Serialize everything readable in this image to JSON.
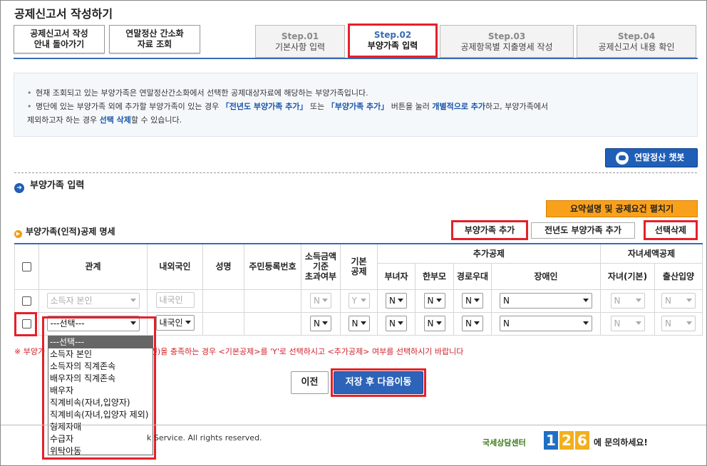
{
  "page": {
    "title": "공제신고서 작성하기"
  },
  "top_buttons": {
    "guide": [
      "공제신고서 작성",
      "안내 돌아가기"
    ],
    "lookup": [
      "연말정산 간소화",
      "자료 조회"
    ]
  },
  "steps": [
    {
      "num": "Step.01",
      "label": "기본사항 입력"
    },
    {
      "num": "Step.02",
      "label": "부양가족 입력"
    },
    {
      "num": "Step.03",
      "label": "공제항목별 지출명세 작성"
    },
    {
      "num": "Step.04",
      "label": "공제신고서 내용 확인"
    }
  ],
  "info": {
    "line1": "현재 조회되고 있는 부양가족은 연말정산간소화에서 선택한 공제대상자료에 해당하는 부양가족입니다.",
    "line2_a": "명단에 있는 부양가족 외에 추가할 부양가족이 있는 경우 ",
    "line2_b": "「전년도 부양가족 추가」",
    "line2_c": " 또는 ",
    "line2_d": "「부양가족 추가」",
    "line2_e": " 버튼을 눌러 ",
    "line2_f": "개별적으로 추가",
    "line2_g": "하고, 부양가족에서",
    "line3_a": "제외하고자 하는 경우 ",
    "line3_b": "선택 삭제",
    "line3_c": "할 수 있습니다."
  },
  "chatbot_label": "연말정산 챗봇",
  "section_title": "부양가족 입력",
  "summary_button": "요약설명 및 공제요건 펼치기",
  "subsection_title": "부양가족(인적)공제 명세",
  "action_buttons": {
    "add": "부양가족 추가",
    "add_prev": "전년도 부양가족 추가",
    "delete": "선택삭제"
  },
  "table": {
    "headers": {
      "relation": "관계",
      "nationality": "내외국인",
      "name": "성명",
      "rrn": "주민등록번호",
      "income": [
        "소득금액",
        "기준",
        "초과여부"
      ],
      "basic": [
        "기본",
        "공제"
      ],
      "extra_group": "추가공제",
      "single_female": "부녀자",
      "single_parent": "한부모",
      "senior": "경로우대",
      "disabled": "장애인",
      "child_group": "자녀세액공제",
      "child_basic": "자녀(기본)",
      "birth": "출산입양"
    },
    "rows": [
      {
        "relation": "소득자 본인",
        "nationality": "내국인",
        "income": "N",
        "basic": "Y",
        "single_female": "N",
        "single_parent": "N",
        "senior": "N",
        "disabled": "N",
        "child_basic": "N",
        "birth": "N"
      },
      {
        "relation": "---선택---",
        "nationality": "내국인",
        "income": "N",
        "basic": "N",
        "single_female": "N",
        "single_parent": "N",
        "senior": "N",
        "disabled": "N",
        "child_basic": "N",
        "birth": "N"
      }
    ]
  },
  "relation_options": [
    "---선택---",
    "소득자 본인",
    "소득자의 직계존속",
    "배우자의 직계존속",
    "배우자",
    "직계비속(자녀,입양자)",
    "직계비속(자녀,입양자 제외)",
    "형제자매",
    "수급자",
    "위탁아동"
  ],
  "note": {
    "left": "※ 부양가",
    "right": "득 요건)을 충족하는 경우 <기본공제>를 'Y'로 선택하시고 <추가공제> 여부를 선택하시기 바랍니다"
  },
  "nav": {
    "prev": "이전",
    "next": "저장 후 다음이동"
  },
  "footer": {
    "copyright": "k Service. All rights reserved.",
    "brand": "국세상담센터",
    "digits": [
      "1",
      "2",
      "6"
    ],
    "ask": "에 문의하세요!"
  },
  "colors": {
    "accent": "#1f5fb8",
    "highlight": "#e5202a",
    "orange": "#f9a11b"
  }
}
